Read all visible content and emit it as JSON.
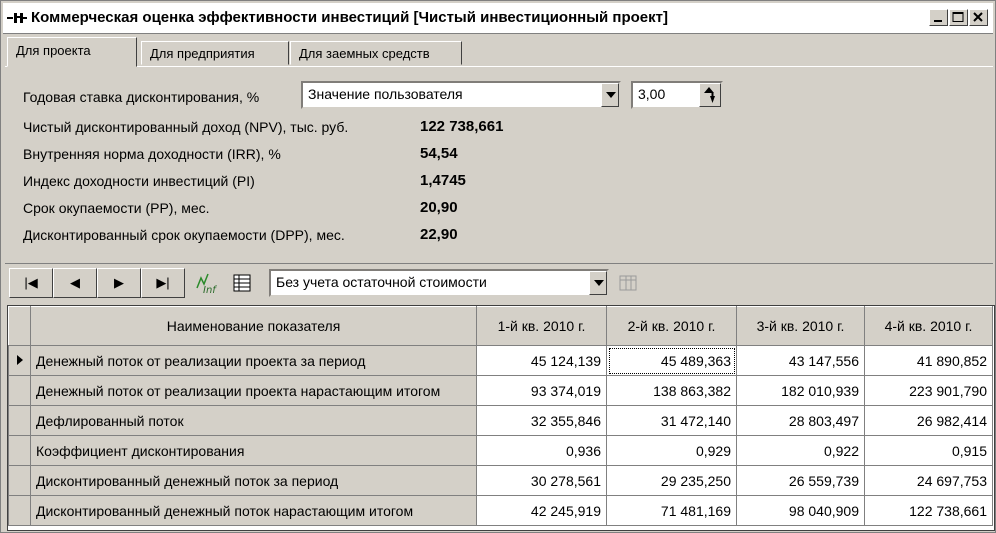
{
  "window": {
    "title": "Коммерческая оценка эффективности инвестиций [Чистый инвестиционный проект]"
  },
  "tabs": [
    {
      "label": "Для проекта",
      "active": true
    },
    {
      "label": "Для предприятия",
      "active": false
    },
    {
      "label": "Для заемных средств",
      "active": false
    }
  ],
  "params": {
    "rate_label": "Годовая ставка дисконтирования, %",
    "rate_mode": "Значение пользователя",
    "rate_value": "3,00",
    "indicators": [
      {
        "label": "Чистый дисконтированный доход (NPV), тыс. руб.",
        "value": "122 738,661"
      },
      {
        "label": "Внутренняя норма доходности (IRR), %",
        "value": "54,54"
      },
      {
        "label": "Индекс доходности инвестиций (PI)",
        "value": "1,4745"
      },
      {
        "label": "Срок окупаемости (PP), мес.",
        "value": "20,90"
      },
      {
        "label": "Дисконтированный срок окупаемости (DPP), мес.",
        "value": "22,90"
      }
    ]
  },
  "toolbar": {
    "first": "|◀",
    "prev": "◀",
    "next": "▶",
    "last": "▶|",
    "residual_mode": "Без учета остаточной стоимости",
    "chart_icon": "chart-inf-icon",
    "table_icon": "table-icon",
    "grid_icon": "grid-disabled-icon"
  },
  "table": {
    "headers": [
      "Наименование показателя",
      "1-й кв. 2010 г.",
      "2-й кв. 2010 г.",
      "3-й кв. 2010 г.",
      "4-й кв. 2010 г."
    ],
    "rows": [
      {
        "name": "Денежный поток от реализации проекта за период",
        "values": [
          "45 124,139",
          "45 489,363",
          "43 147,556",
          "41 890,852"
        ]
      },
      {
        "name": "Денежный поток от реализации проекта нарастающим итогом",
        "values": [
          "93 374,019",
          "138 863,382",
          "182 010,939",
          "223 901,790"
        ]
      },
      {
        "name": "Дефлированный поток",
        "values": [
          "32 355,846",
          "31 472,140",
          "28 803,497",
          "26 982,414"
        ]
      },
      {
        "name": "Коэффициент дисконтирования",
        "values": [
          "0,936",
          "0,929",
          "0,922",
          "0,915"
        ]
      },
      {
        "name": "Дисконтированный денежный поток за период",
        "values": [
          "30 278,561",
          "29 235,250",
          "26 559,739",
          "24 697,753"
        ]
      },
      {
        "name": "Дисконтированный денежный поток нарастающим итогом",
        "values": [
          "42 245,919",
          "71 481,169",
          "98 040,909",
          "122 738,661"
        ]
      }
    ]
  }
}
